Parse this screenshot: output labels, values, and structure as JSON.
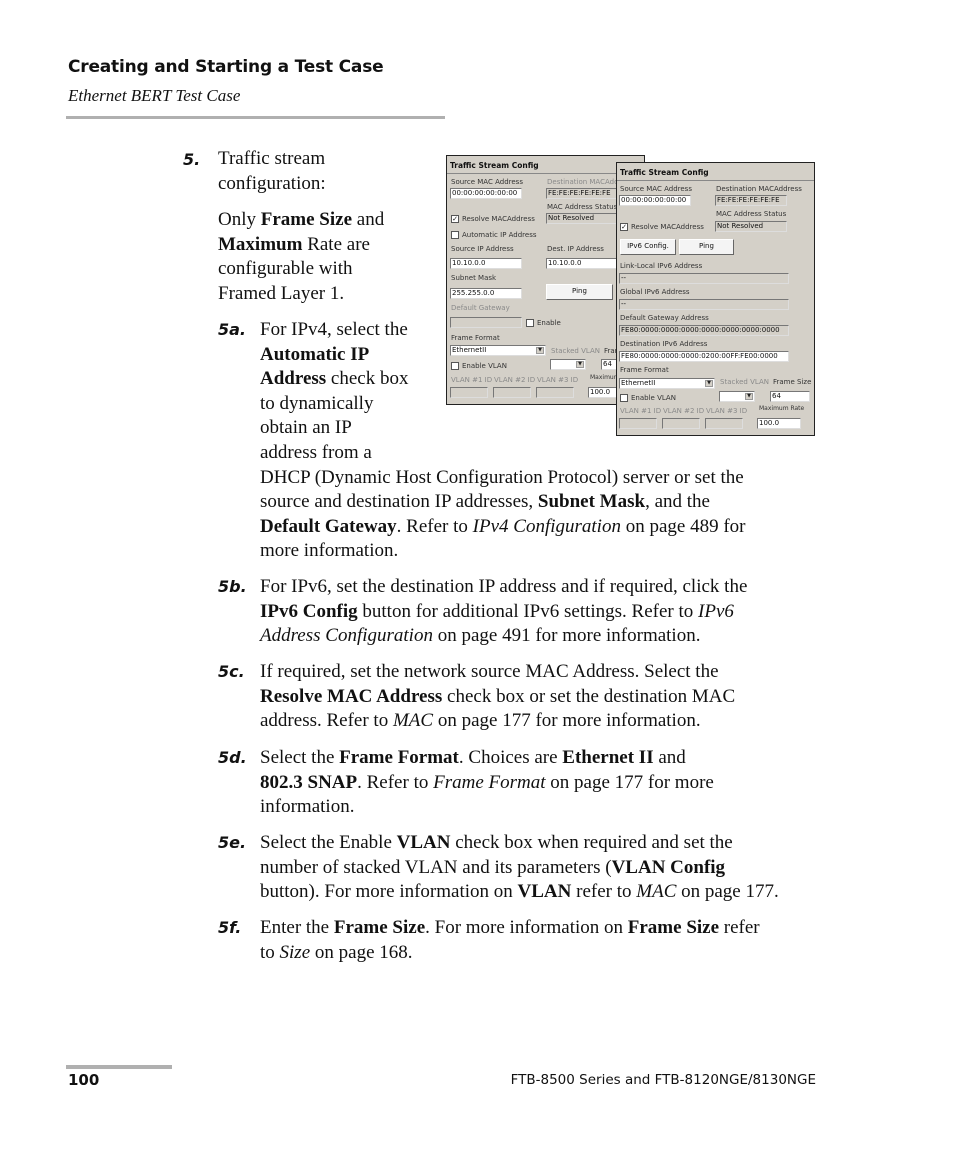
{
  "header": {
    "title": "Creating and Starting a Test Case",
    "subtitle": "Ethernet BERT Test Case"
  },
  "step5": {
    "number": "5.",
    "lines": [
      "Traffic stream",
      "configuration:"
    ],
    "note": {
      "p1": "Only ",
      "b1": "Frame Size",
      "p2": " and",
      "b2": "Maximum",
      "p3": " Rate are",
      "p4": "configurable with",
      "p5": "Framed Layer 1."
    }
  },
  "substeps": {
    "a": {
      "number": "5a.",
      "t1": "For IPv4, select the",
      "b1": "Automatic IP",
      "b2": "Address",
      "t2": " check box",
      "t3": "to dynamically",
      "t4": "obtain an IP",
      "t5": "address from a",
      "t6": "DHCP (Dynamic Host Configuration Protocol) server or set the",
      "t7": "source and destination IP addresses, ",
      "b3": "Subnet Mask",
      "t8": ", and the",
      "b4": "Default Gateway",
      "t9": ". Refer to ",
      "i1": "IPv4 Configuration",
      "t10": " on page 489 for",
      "t11": "more information."
    },
    "b": {
      "number": "5b.",
      "t1": "For IPv6, set the destination IP address and if required, click the",
      "b1": "IPv6 Config",
      "t2": " button for additional IPv6 settings. Refer to ",
      "i1": "IPv6",
      "i2": "Address Configuration",
      "t3": " on page 491 for more information."
    },
    "c": {
      "number": "5c.",
      "t1": "If required, set the network source MAC Address. Select the",
      "b1": "Resolve MAC Address",
      "t2": " check box or set the destination MAC",
      "t3": "address. Refer to ",
      "i1": "MAC",
      "t4": " on page 177 for more information."
    },
    "d": {
      "number": "5d.",
      "t1": "Select the ",
      "b1": "Frame Format",
      "t2": ". Choices are ",
      "b2": "Ethernet II",
      "t3": " and",
      "b3": "802.3 SNAP",
      "t4": ". Refer to ",
      "i1": "Frame Format",
      "t5": " on page 177 for more",
      "t6": "information."
    },
    "e": {
      "number": "5e.",
      "t1": "Select the Enable ",
      "b1": "VLAN",
      "t2": " check box when required and set the",
      "t3": "number of stacked VLAN and its parameters (",
      "b2": "VLAN Config",
      "t4": "button). For more information on ",
      "b3": "VLAN",
      "t5": " refer to ",
      "i1": "MAC",
      "t6": " on page 177."
    },
    "f": {
      "number": "5f.",
      "t1": "Enter the ",
      "b1": "Frame Size",
      "t2": ". For more information on ",
      "b2": "Frame Size",
      "t3": " refer",
      "t4": "to ",
      "i1": "Size",
      "t5": " on page 168."
    }
  },
  "dialog_ipv4": {
    "title": "Traffic Stream Config",
    "source_mac_label": "Source MAC Address",
    "source_mac": "00:00:00:00:00:00",
    "dest_mac_label": "Destination MACAddress",
    "dest_mac": "FE:FE:FE:FE:FE:FE",
    "mac_status_label": "MAC Address Status",
    "mac_status": "Not Resolved",
    "resolve_mac_label": "Resolve MACAddress",
    "resolve_mac_checked": true,
    "auto_ip_label": "Automatic IP Address",
    "auto_ip_checked": false,
    "source_ip_label": "Source IP Address",
    "source_ip": "10.10.0.0",
    "dest_ip_label": "Dest. IP Address",
    "dest_ip": "10.10.0.0",
    "subnet_label": "Subnet Mask",
    "subnet": "255.255.0.0",
    "ping_label": "Ping",
    "gateway_label": "Default Gateway",
    "gateway": "",
    "gateway_enable_label": "Enable",
    "gateway_enable_checked": false,
    "frame_format_label": "Frame Format",
    "frame_format": "EthernetII",
    "stacked_vlan_label": "Stacked VLAN",
    "frame_size_label": "Frame Size",
    "frame_size": "64",
    "enable_vlan_label": "Enable VLAN",
    "enable_vlan_checked": false,
    "vlan1_label": "VLAN #1 ID",
    "vlan2_label": "VLAN #2 ID",
    "vlan3_label": "VLAN #3 ID",
    "max_rate_label": "Maximum Rate",
    "max_rate": "100.0"
  },
  "dialog_ipv6": {
    "title": "Traffic Stream Config",
    "source_mac_label": "Source MAC Address",
    "source_mac": "00:00:00:00:00:00",
    "dest_mac_label": "Destination MACAddress",
    "dest_mac": "FE:FE:FE:FE:FE:FE",
    "mac_status_label": "MAC Address Status",
    "mac_status": "Not Resolved",
    "resolve_mac_label": "Resolve MACAddress",
    "resolve_mac_checked": true,
    "ipv6_config_label": "IPv6 Config.",
    "ping_label": "Ping",
    "link_local_label": "Link-Local IPv6 Address",
    "link_local": "--",
    "global_label": "Global IPv6 Address",
    "global": "--",
    "gateway_label": "Default Gateway Address",
    "gateway": "FE80:0000:0000:0000:0000:0000:0000:0000",
    "dest_ipv6_label": "Destination IPv6 Address",
    "dest_ipv6": "FE80:0000:0000:0000:0200:00FF:FE00:0000",
    "frame_format_label": "Frame Format",
    "frame_format": "EthernetII",
    "stacked_vlan_label": "Stacked VLAN",
    "frame_size_label": "Frame Size",
    "frame_size": "64",
    "enable_vlan_label": "Enable VLAN",
    "enable_vlan_checked": false,
    "vlan1_label": "VLAN #1 ID",
    "vlan2_label": "VLAN #2 ID",
    "vlan3_label": "VLAN #3 ID",
    "max_rate_label": "Maximum Rate",
    "max_rate": "100.0"
  },
  "footer": {
    "page_number": "100",
    "product": "FTB-8500 Series and FTB-8120NGE/8130NGE"
  }
}
